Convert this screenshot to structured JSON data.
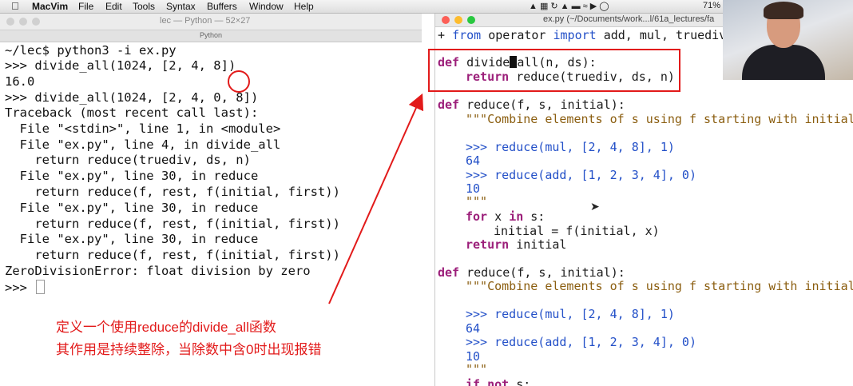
{
  "menubar": {
    "app": "MacVim",
    "items": [
      "File",
      "Edit",
      "Tools",
      "Syntax",
      "Buffers",
      "Window",
      "Help"
    ],
    "battery": "71%"
  },
  "terminal": {
    "title": "lec — Python — 52×27",
    "tab": "Python",
    "lines": [
      "~/lec$ python3 -i ex.py",
      ">>> divide_all(1024, [2, 4, 8])",
      "16.0",
      ">>> divide_all(1024, [2, 4, 0, 8])",
      "Traceback (most recent call last):",
      "  File \"<stdin>\", line 1, in <module>",
      "  File \"ex.py\", line 4, in divide_all",
      "    return reduce(truediv, ds, n)",
      "  File \"ex.py\", line 30, in reduce",
      "    return reduce(f, rest, f(initial, first))",
      "  File \"ex.py\", line 30, in reduce",
      "    return reduce(f, rest, f(initial, first))",
      "  File \"ex.py\", line 30, in reduce",
      "    return reduce(f, rest, f(initial, first))",
      "ZeroDivisionError: float division by zero"
    ],
    "prompt": ">>> "
  },
  "vim": {
    "title": "ex.py (~/Documents/work...l/61a_lectures/fa",
    "line_import_plus": "+",
    "line_import_kw1": "from",
    "line_import_mid": " operator ",
    "line_import_kw2": "import",
    "line_import_rest": " add, mul, truediv",
    "def1_kw": "def",
    "def1_pre": " divide",
    "def1_post": "all(n, ds):",
    "def1_ret_kw": "return",
    "def1_ret_rest": " reduce(truediv, ds, n)",
    "def2_kw": "def",
    "def2_rest": " reduce(f, s, initial):",
    "doc_line": "\"\"\"Combine elements of s using f starting with initial.",
    "ex1_prompt": ">>>",
    "ex1": " reduce(mul, [2, 4, 8], 1)",
    "ex1_out": "64",
    "ex2_prompt": ">>>",
    "ex2": " reduce(add, [1, 2, 3, 4], 0)",
    "ex2_out": "10",
    "doc_end": "\"\"\"",
    "for_kw": "for",
    "for_mid": " x ",
    "in_kw": "in",
    "for_rest": " s:",
    "assign": "initial = f(initial, x)",
    "ret2_kw": "return",
    "ret2_rest": " initial",
    "def3_kw": "def",
    "def3_rest": " reduce(f, s, initial):",
    "doc_line2": "\"\"\"Combine elements of s using f starting with initial.",
    "ex3_prompt": ">>>",
    "ex3": " reduce(mul, [2, 4, 8], 1)",
    "ex3_out": "64",
    "ex4_prompt": ">>>",
    "ex4": " reduce(add, [1, 2, 3, 4], 0)",
    "ex4_out": "10",
    "doc_end2": "\"\"\"",
    "if_kw1": "if",
    "if_kw2": "not",
    "if_rest": " s:"
  },
  "caption": {
    "line1": "定义一个使用reduce的divide_all函数",
    "line2": "其作用是持续整除，当除数中含0时出现报错"
  },
  "colors": {
    "annotation_red": "#e21a1a",
    "keyword": "#9c1f7a",
    "docstring": "#8b5e10",
    "doctest": "#2350c8"
  }
}
